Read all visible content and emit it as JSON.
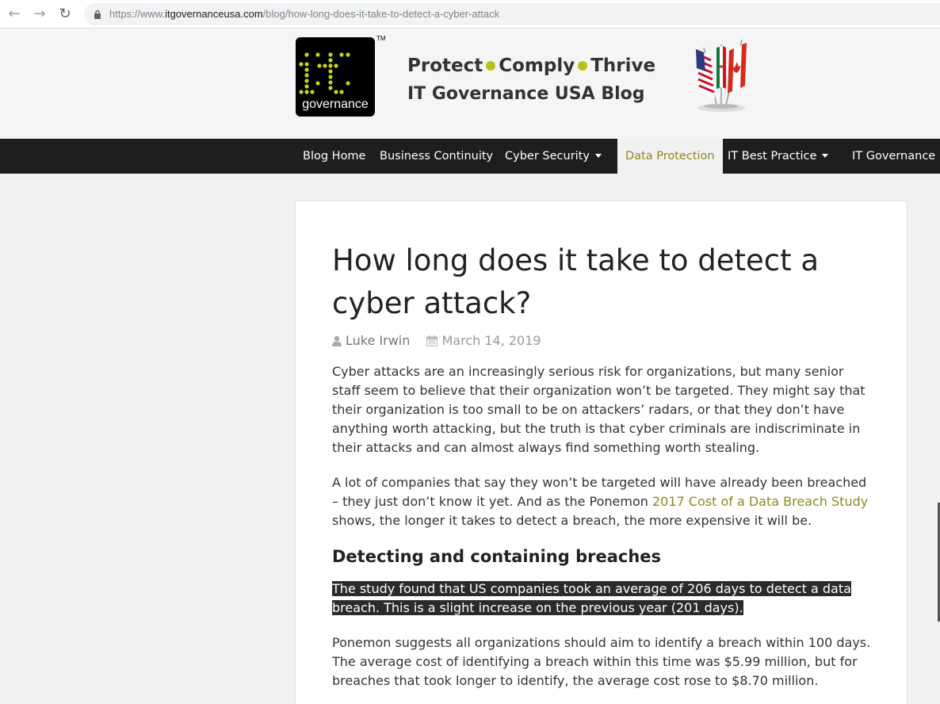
{
  "browser": {
    "url_prefix": "https://www.",
    "url_domain": "itgovernanceusa.com",
    "url_path": "/blog/how-long-does-it-take-to-detect-a-cyber-attack"
  },
  "header": {
    "logo_word": "governance",
    "logo_tm": "TM",
    "tagline_1": "Protect",
    "tagline_2": "Comply",
    "tagline_3": "Thrive",
    "blog_title": "IT Governance USA Blog"
  },
  "nav": {
    "items": [
      {
        "label": "Blog Home"
      },
      {
        "label": "Business Continuity"
      },
      {
        "label": "Cyber Security"
      },
      {
        "label": "Data Protection"
      },
      {
        "label": "IT Best Practice"
      },
      {
        "label": "IT Governance"
      }
    ]
  },
  "article": {
    "title": "How long does it take to detect a cyber attack?",
    "author": "Luke Irwin",
    "date": "March 14, 2019",
    "p1": "Cyber attacks are an increasingly serious risk for organizations, but many senior staff seem to believe that their organization won’t be targeted. They might say that their organization is too small to be on attackers’ radars, or that they don’t have anything worth attacking, but the truth is that cyber criminals are indiscriminate in their attacks and can almost always find something worth stealing.",
    "p2_before": "A lot of companies that say they won’t be targeted will have already been breached – they just don’t know it yet. And as the Ponemon ",
    "p2_link": "2017 Cost of a Data Breach Study",
    "p2_after": " shows, the longer it takes to detect a breach, the more expensive it will be.",
    "subheading": "Detecting and containing breaches",
    "highlighted": "The study found that US companies took an average of 206 days to detect a data breach. This is a slight increase on the previous year (201 days).",
    "p3": "Ponemon suggests all organizations should aim to identify a breach within 100 days. The average cost of identifying a breach within this time was $5.99 million, but for breaches that took longer to identify, the average cost rose to $8.70 million."
  },
  "colors": {
    "accent": "#8b8a22",
    "nav_bg": "#1e1e1e",
    "dot": "#b9c11b"
  }
}
